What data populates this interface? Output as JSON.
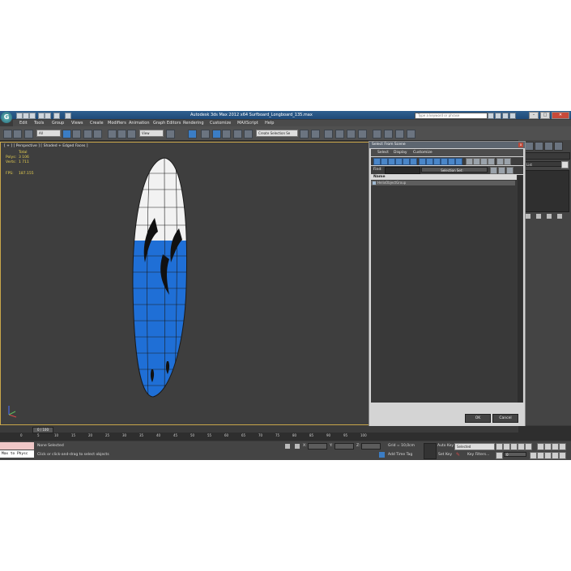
{
  "app": {
    "title": "Autodesk 3ds Max  2012 x64    Surfboard_Longboard_135.max",
    "logo_glyph": "G",
    "search_placeholder": "Type a keyword or phrase"
  },
  "menu": [
    "Edit",
    "Tools",
    "Group",
    "Views",
    "Create",
    "Modifiers",
    "Animation",
    "Graph Editors",
    "Rendering",
    "Customize",
    "MAXScript",
    "Help"
  ],
  "toolbar": {
    "filter_value": "All",
    "refcoord_value": "View",
    "named_selection_placeholder": "Create Selection Se"
  },
  "viewport": {
    "label": "[ + ] [ Perspective ] [ Shaded + Edged Faces ]",
    "stats": {
      "total_label": "Total",
      "polys_label": "Polys:",
      "polys_value": "3 106",
      "verts_label": "Verts:",
      "verts_value": "1 711",
      "fps_label": "FPS:",
      "fps_value": "187.155"
    }
  },
  "command_panel": {
    "list_label": "List"
  },
  "dialog": {
    "title": "Select From Scene",
    "close_glyph": "x",
    "menus": [
      "Select",
      "Display",
      "Customize"
    ],
    "find_label": "Find:",
    "selection_sets_label": "Selection Set:",
    "column_name": "Name",
    "rows": [
      "HelixObjectGroup"
    ],
    "ok_label": "OK",
    "cancel_label": "Cancel"
  },
  "timeline": {
    "frame_counter": "0 / 100",
    "ticks": [
      "0",
      "5",
      "10",
      "15",
      "20",
      "25",
      "30",
      "35",
      "40",
      "45",
      "50",
      "55",
      "60",
      "65",
      "70",
      "75",
      "80",
      "85",
      "90",
      "95",
      "100"
    ]
  },
  "statusbar": {
    "listener_text": "Max to Physc",
    "selection_status": "None Selected",
    "prompt": "Click or click-and-drag to select objects",
    "x_label": "X:",
    "y_label": "Y:",
    "z_label": "Z:",
    "grid_label": "Grid = 10,0cm",
    "add_time_tag": "Add Time Tag",
    "auto_key": "Auto Key",
    "auto_key_value": "Selected",
    "set_key": "Set Key",
    "key_filters": "Key Filters...",
    "frame_value": "0"
  },
  "colors": {
    "board_blue": "#1f6fd6",
    "board_white": "#f2f2f2",
    "viewport_border": "#c9a64a",
    "stats_yellow": "#e8d050"
  }
}
